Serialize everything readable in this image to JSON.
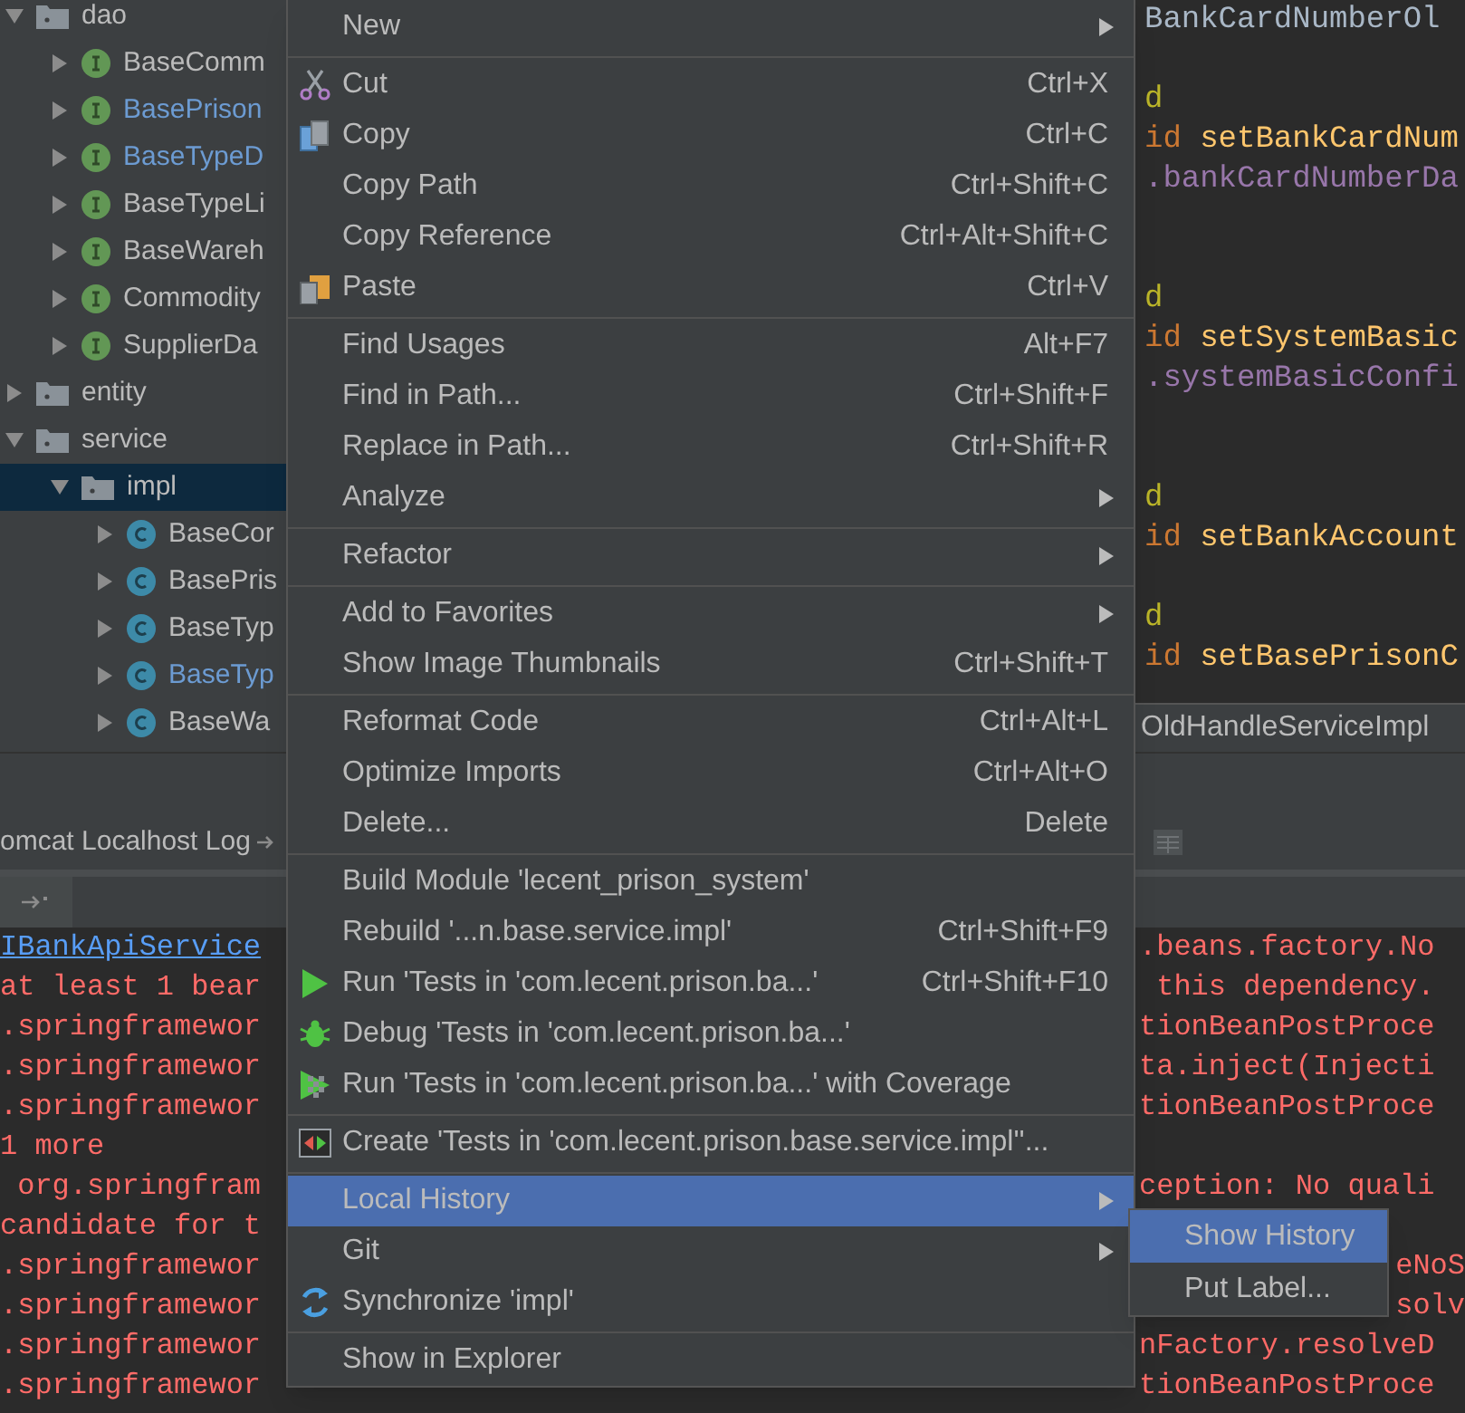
{
  "project_tree": [
    {
      "label": "dao",
      "kind": "folder",
      "expanded": true,
      "selected": false,
      "modified": false,
      "children": [
        {
          "label": "BaseComm",
          "kind": "interface",
          "expanded": false,
          "selected": false,
          "modified": false
        },
        {
          "label": "BasePrison",
          "kind": "interface",
          "expanded": false,
          "selected": false,
          "modified": true
        },
        {
          "label": "BaseTypeD",
          "kind": "interface",
          "expanded": false,
          "selected": false,
          "modified": true
        },
        {
          "label": "BaseTypeLi",
          "kind": "interface",
          "expanded": false,
          "selected": false,
          "modified": false
        },
        {
          "label": "BaseWareh",
          "kind": "interface",
          "expanded": false,
          "selected": false,
          "modified": false
        },
        {
          "label": "Commodity",
          "kind": "interface",
          "expanded": false,
          "selected": false,
          "modified": false
        },
        {
          "label": "SupplierDa",
          "kind": "interface",
          "expanded": false,
          "selected": false,
          "modified": false
        }
      ]
    },
    {
      "label": "entity",
      "kind": "folder",
      "expanded": false,
      "selected": false,
      "modified": false
    },
    {
      "label": "service",
      "kind": "folder",
      "expanded": true,
      "selected": false,
      "modified": false,
      "children": [
        {
          "label": "impl",
          "kind": "folder",
          "expanded": true,
          "selected": true,
          "modified": false,
          "children": [
            {
              "label": "BaseCor",
              "kind": "class",
              "expanded": false,
              "selected": false,
              "modified": false
            },
            {
              "label": "BasePris",
              "kind": "class",
              "expanded": false,
              "selected": false,
              "modified": false
            },
            {
              "label": "BaseTyp",
              "kind": "class",
              "expanded": false,
              "selected": false,
              "modified": false
            },
            {
              "label": "BaseTyp",
              "kind": "class",
              "expanded": false,
              "selected": false,
              "modified": true
            },
            {
              "label": "BaseWa",
              "kind": "class",
              "expanded": false,
              "selected": false,
              "modified": false
            }
          ]
        }
      ]
    }
  ],
  "editor": {
    "lines": [
      {
        "kind": "code",
        "tokens": [
          {
            "kind": "plain",
            "text": "BankCardNumberOl"
          }
        ]
      },
      {
        "kind": "blank"
      },
      {
        "kind": "code",
        "tokens": [
          {
            "kind": "annotation",
            "text": "d"
          }
        ]
      },
      {
        "kind": "code",
        "tokens": [
          {
            "kind": "keyword",
            "text": "id"
          },
          {
            "kind": "method",
            "text": " setBankCardNum"
          }
        ]
      },
      {
        "kind": "code",
        "tokens": [
          {
            "kind": "field",
            "text": ".bankCardNumberDa"
          }
        ]
      },
      {
        "kind": "blank"
      },
      {
        "kind": "blank"
      },
      {
        "kind": "code",
        "tokens": [
          {
            "kind": "annotation",
            "text": "d"
          }
        ]
      },
      {
        "kind": "code",
        "tokens": [
          {
            "kind": "keyword",
            "text": "id"
          },
          {
            "kind": "method",
            "text": " setSystemBasic"
          }
        ]
      },
      {
        "kind": "code",
        "tokens": [
          {
            "kind": "field",
            "text": ".systemBasicConfi"
          }
        ]
      },
      {
        "kind": "blank"
      },
      {
        "kind": "blank"
      },
      {
        "kind": "code",
        "tokens": [
          {
            "kind": "annotation",
            "text": "d"
          }
        ]
      },
      {
        "kind": "code",
        "tokens": [
          {
            "kind": "keyword",
            "text": "id"
          },
          {
            "kind": "method",
            "text": " setBankAccount"
          }
        ]
      },
      {
        "kind": "blank"
      },
      {
        "kind": "code",
        "tokens": [
          {
            "kind": "annotation",
            "text": "d"
          }
        ]
      },
      {
        "kind": "code",
        "tokens": [
          {
            "kind": "keyword",
            "text": "id"
          },
          {
            "kind": "method",
            "text": " setBasePrisonC"
          }
        ]
      }
    ],
    "breadcrumb": "OldHandleServiceImpl"
  },
  "run_panel": {
    "tab": "omcat Localhost Log"
  },
  "console": [
    {
      "left": "IBankApiService",
      "link": true,
      "right": ".beans.factory.No",
      "kind": "full"
    },
    {
      "left": "at least 1 bear",
      "link": false,
      "right": " this dependency.",
      "kind": "full"
    },
    {
      "left": ".springframewor",
      "link": false,
      "right": "tionBeanPostProce",
      "kind": "full"
    },
    {
      "left": ".springframewor",
      "link": false,
      "right": "ta.inject(Injecti",
      "kind": "full"
    },
    {
      "left": ".springframewor",
      "link": false,
      "right": "tionBeanPostProce",
      "kind": "full"
    },
    {
      "left": "1 more",
      "link": false,
      "kind": "full"
    },
    {
      "left": " org.springfram",
      "link": false,
      "right": "ception: No quali",
      "kind": "full"
    },
    {
      "left": "candidate for t",
      "link": false,
      "kind": "full"
    },
    {
      "left": ".springframewor",
      "link": false,
      "right": "eNoS",
      "kind": "tail"
    },
    {
      "left": ".springframewor",
      "link": false,
      "right": "solv",
      "kind": "tail"
    },
    {
      "left": ".springframewor",
      "link": false,
      "right": "nFactory.resolveD",
      "kind": "full"
    },
    {
      "left": ".springframewor",
      "link": false,
      "right": "tionBeanPostProce",
      "kind": "full"
    }
  ],
  "context_menu": {
    "sections": [
      {
        "items": [
          {
            "label": "New",
            "kind": "plain",
            "has_submenu": true,
            "selected": false
          }
        ]
      },
      {
        "items": [
          {
            "label": "Cut",
            "shortcut": "Ctrl+X",
            "kind": "cut",
            "has_submenu": false,
            "selected": false
          },
          {
            "label": "Copy",
            "shortcut": "Ctrl+C",
            "kind": "copy",
            "has_submenu": false,
            "selected": false
          },
          {
            "label": "Copy Path",
            "shortcut": "Ctrl+Shift+C",
            "kind": "plain",
            "has_submenu": false,
            "selected": false
          },
          {
            "label": "Copy Reference",
            "shortcut": "Ctrl+Alt+Shift+C",
            "kind": "plain",
            "has_submenu": false,
            "selected": false
          },
          {
            "label": "Paste",
            "shortcut": "Ctrl+V",
            "kind": "paste",
            "has_submenu": false,
            "selected": false
          }
        ]
      },
      {
        "items": [
          {
            "label": "Find Usages",
            "shortcut": "Alt+F7",
            "kind": "plain",
            "has_submenu": false,
            "selected": false
          },
          {
            "label": "Find in Path...",
            "shortcut": "Ctrl+Shift+F",
            "kind": "plain",
            "has_submenu": false,
            "selected": false
          },
          {
            "label": "Replace in Path...",
            "shortcut": "Ctrl+Shift+R",
            "kind": "plain",
            "has_submenu": false,
            "selected": false
          },
          {
            "label": "Analyze",
            "kind": "plain",
            "has_submenu": true,
            "selected": false
          }
        ]
      },
      {
        "items": [
          {
            "label": "Refactor",
            "kind": "plain",
            "has_submenu": true,
            "selected": false
          }
        ]
      },
      {
        "items": [
          {
            "label": "Add to Favorites",
            "kind": "plain",
            "has_submenu": true,
            "selected": false
          },
          {
            "label": "Show Image Thumbnails",
            "shortcut": "Ctrl+Shift+T",
            "kind": "plain",
            "has_submenu": false,
            "selected": false
          }
        ]
      },
      {
        "items": [
          {
            "label": "Reformat Code",
            "shortcut": "Ctrl+Alt+L",
            "kind": "plain",
            "has_submenu": false,
            "selected": false
          },
          {
            "label": "Optimize Imports",
            "shortcut": "Ctrl+Alt+O",
            "kind": "plain",
            "has_submenu": false,
            "selected": false
          },
          {
            "label": "Delete...",
            "shortcut": "Delete",
            "kind": "plain",
            "has_submenu": false,
            "selected": false
          }
        ]
      },
      {
        "items": [
          {
            "label": "Build Module 'lecent_prison_system'",
            "kind": "plain",
            "has_submenu": false,
            "selected": false
          },
          {
            "label": "Rebuild '...n.base.service.impl'",
            "shortcut": "Ctrl+Shift+F9",
            "kind": "plain",
            "has_submenu": false,
            "selected": false
          },
          {
            "label": "Run 'Tests in 'com.lecent.prison.ba...'",
            "shortcut": "Ctrl+Shift+F10",
            "kind": "run",
            "has_submenu": false,
            "selected": false
          },
          {
            "label": "Debug 'Tests in 'com.lecent.prison.ba...'",
            "kind": "debug",
            "has_submenu": false,
            "selected": false
          },
          {
            "label": "Run 'Tests in 'com.lecent.prison.ba...' with Coverage",
            "kind": "coverage",
            "has_submenu": false,
            "selected": false
          }
        ]
      },
      {
        "items": [
          {
            "label": "Create 'Tests in 'com.lecent.prison.base.service.impl''...",
            "kind": "create",
            "has_submenu": false,
            "selected": false
          }
        ]
      },
      {
        "items": [
          {
            "label": "Local History",
            "kind": "plain",
            "has_submenu": true,
            "selected": true
          },
          {
            "label": "Git",
            "kind": "plain",
            "has_submenu": true,
            "selected": false
          },
          {
            "label": "Synchronize 'impl'",
            "kind": "sync",
            "has_submenu": false,
            "selected": false
          }
        ]
      },
      {
        "items": [
          {
            "label": "Show in Explorer",
            "kind": "plain",
            "has_submenu": false,
            "selected": false
          }
        ]
      }
    ]
  },
  "submenu": {
    "items": [
      {
        "label": "Show History",
        "selected": true
      },
      {
        "label": "Put Label...",
        "selected": false
      }
    ]
  }
}
